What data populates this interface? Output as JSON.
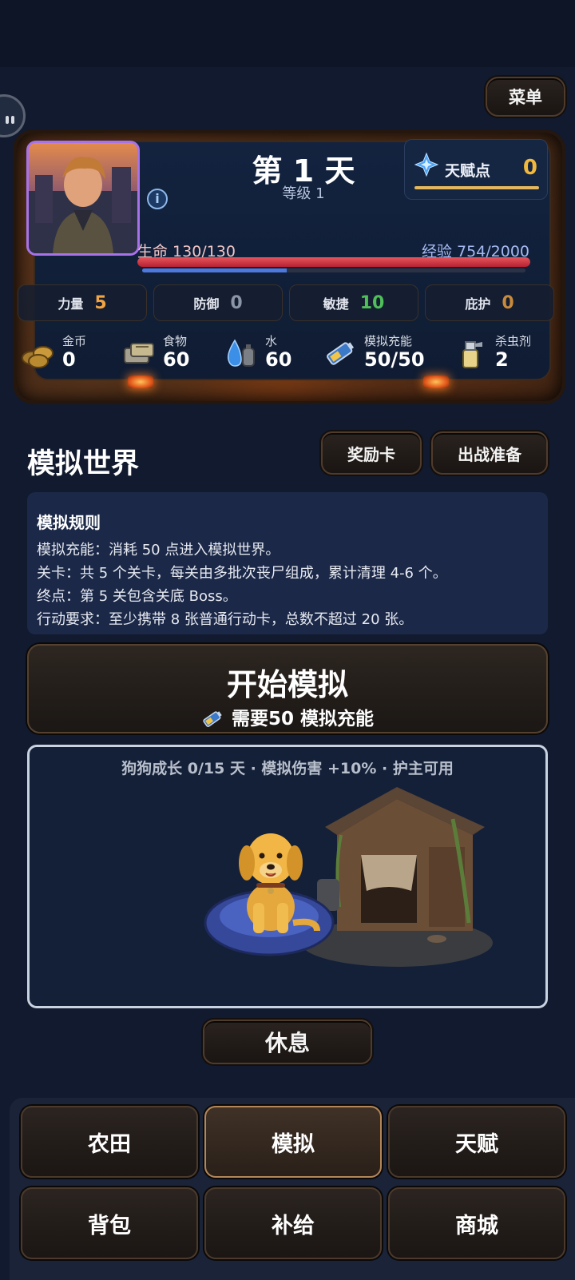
{
  "header": {
    "menu_label": "菜单"
  },
  "player": {
    "day_title": "第 1 天",
    "level_text": "等级 1",
    "talent_label": "天赋点",
    "talent_value": "0",
    "hp_text": "生命 130/130",
    "hp_fraction": 1.0,
    "xp_text": "经验 754/2000",
    "xp_fraction": 0.377
  },
  "stats": [
    {
      "label": "力量",
      "value": "5",
      "color": "#f0a542"
    },
    {
      "label": "防御",
      "value": "0",
      "color": "#8a96a8"
    },
    {
      "label": "敏捷",
      "value": "10",
      "color": "#4fbf5a"
    },
    {
      "label": "庇护",
      "value": "0",
      "color": "#c98a3c"
    }
  ],
  "resources": [
    {
      "name": "金币",
      "value": "0",
      "icon": "coins-icon"
    },
    {
      "name": "食物",
      "value": "60",
      "icon": "food-icon"
    },
    {
      "name": "水",
      "value": "60",
      "icon": "water-icon"
    },
    {
      "name": "模拟充能",
      "value": "50/50",
      "icon": "battery-icon"
    },
    {
      "name": "杀虫剂",
      "value": "2",
      "icon": "spray-icon"
    }
  ],
  "simulation": {
    "section_title": "模拟世界",
    "reward_btn": "奖励卡",
    "prep_btn": "出战准备",
    "rules_title": "模拟规则",
    "rules": [
      "模拟充能：消耗 50 点进入模拟世界。",
      "关卡：共 5 个关卡，每关由多批次丧尸组成，累计清理 4-6 个。",
      "终点：第 5 关包含关底 Boss。",
      "行动要求：至少携带 8 张普通行动卡，总数不超过 20 张。"
    ],
    "start_title": "开始模拟",
    "start_sub": "需要50 模拟充能"
  },
  "dog": {
    "status": "狗狗成长 0/15 天 · 模拟伤害 +10% · 护主可用"
  },
  "rest_btn": "休息",
  "nav": [
    {
      "label": "农田",
      "active": false
    },
    {
      "label": "模拟",
      "active": true
    },
    {
      "label": "天赋",
      "active": false
    },
    {
      "label": "背包",
      "active": false
    },
    {
      "label": "补给",
      "active": false
    },
    {
      "label": "商城",
      "active": false
    }
  ]
}
